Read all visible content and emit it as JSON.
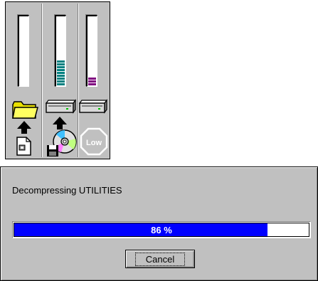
{
  "billboard": {
    "gauges": [
      {
        "name": "source-files",
        "level_fraction": 0.0,
        "color": "#008080"
      },
      {
        "name": "disk-space-progress",
        "level_fraction": 0.36,
        "color": "#008080"
      },
      {
        "name": "free-disk-space",
        "level_fraction": 0.14,
        "color": "#800080"
      }
    ],
    "low_label": "Low"
  },
  "dialog": {
    "status_text": "Decompressing UTILITIES",
    "progress_fraction": 0.86,
    "progress_text": "86 %",
    "progress_color": "#0000ff",
    "cancel_label": "Cancel"
  }
}
